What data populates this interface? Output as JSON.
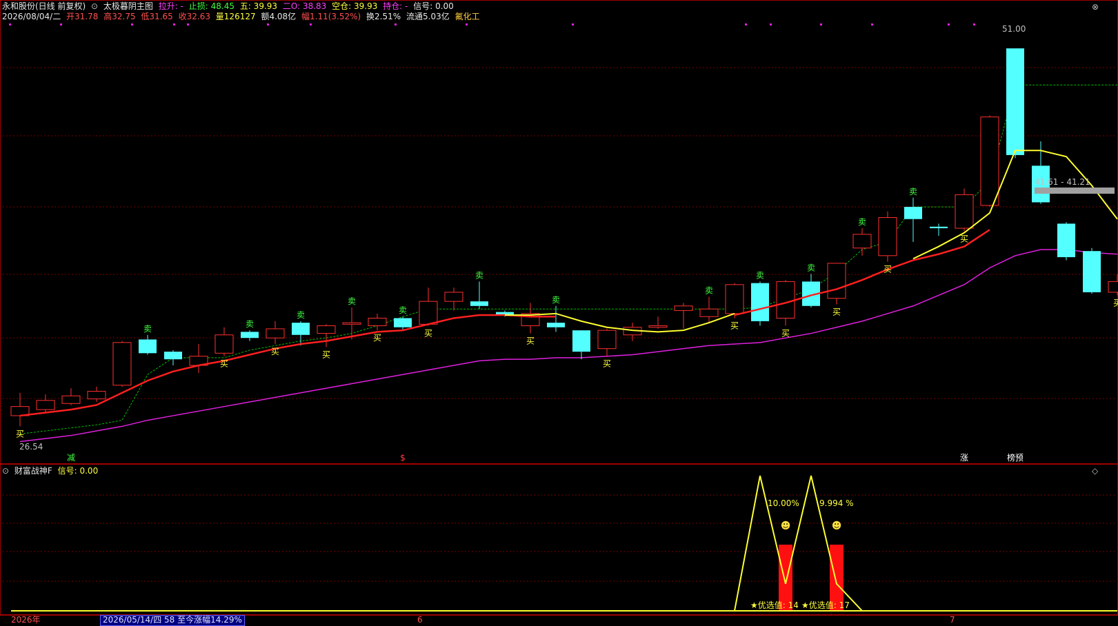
{
  "header": {
    "stock": "永和股份(日线 前复权)",
    "indicator": "太极暮阴主图",
    "pull_label": "拉升: -",
    "stop_loss": "止损: 48.45",
    "five": "五: 39.93",
    "two_o": "二O: 38.83",
    "short": "空仓: 39.93",
    "hold": "持仓: -",
    "signal": "信号: 0.00"
  },
  "quote": {
    "date": "2026/08/04/二",
    "open": "开31.78",
    "high": "高32.75",
    "low": "低31.65",
    "close": "收32.63",
    "volume": "量126127",
    "amount": "额4.08亿",
    "change": "幅1.11(3.52%)",
    "turnover": "换2.51%",
    "float": "流通5.03亿",
    "sector": "氟化工"
  },
  "sub": {
    "title": "财富战神F",
    "signal": "信号: 0.00",
    "pct1": "10.00%",
    "pct2": "9.994 %",
    "best1": "★优选值: 14",
    "best2": "★优选值: 17"
  },
  "bottom": {
    "year": "2026年",
    "date_info": "2026/05/14/四 58 至今涨幅14.29%",
    "m6": "6",
    "m7": "7"
  },
  "colors": {
    "up": "#ff3030",
    "down": "#54ffff",
    "ma_red": "#ff2020",
    "ma_yellow": "#ffff30",
    "ma_mag": "#e020e0",
    "dash_green": "#00c000",
    "buy": "#ffff40",
    "sell": "#40ff40"
  },
  "chart_data": {
    "type": "candlestick",
    "y_axis": "price (CNY)",
    "ylim": [
      24.5,
      52.5
    ],
    "grid": true,
    "price_labels": {
      "high_label": "51.00",
      "low_label": "26.54",
      "range_label": "41.61 - 41.21"
    },
    "candles": [
      {
        "o": 26.9,
        "c": 27.5,
        "h": 28.4,
        "l": 26.2
      },
      {
        "o": 27.3,
        "c": 27.9,
        "h": 28.3,
        "l": 27.1
      },
      {
        "o": 27.7,
        "c": 28.2,
        "h": 28.7,
        "l": 27.6
      },
      {
        "o": 28.0,
        "c": 28.5,
        "h": 28.8,
        "l": 27.8
      },
      {
        "o": 28.9,
        "c": 31.7,
        "h": 31.8,
        "l": 28.8
      },
      {
        "o": 31.9,
        "c": 31.0,
        "h": 32.2,
        "l": 30.9
      },
      {
        "o": 31.1,
        "c": 30.6,
        "h": 31.2,
        "l": 30.2
      },
      {
        "o": 30.2,
        "c": 30.8,
        "h": 31.6,
        "l": 29.7
      },
      {
        "o": 31.0,
        "c": 32.2,
        "h": 32.7,
        "l": 30.8
      },
      {
        "o": 32.4,
        "c": 32.0,
        "h": 32.5,
        "l": 31.8
      },
      {
        "o": 32.0,
        "c": 32.6,
        "h": 33.1,
        "l": 31.6
      },
      {
        "o": 33.0,
        "c": 32.2,
        "h": 33.1,
        "l": 31.5
      },
      {
        "o": 32.3,
        "c": 32.8,
        "h": 32.9,
        "l": 31.4
      },
      {
        "o": 32.9,
        "c": 33.0,
        "h": 34.0,
        "l": 31.9
      },
      {
        "o": 32.8,
        "c": 33.3,
        "h": 33.6,
        "l": 32.5
      },
      {
        "o": 33.3,
        "c": 32.7,
        "h": 33.4,
        "l": 32.5
      },
      {
        "o": 32.9,
        "c": 34.4,
        "h": 35.3,
        "l": 32.8
      },
      {
        "o": 34.4,
        "c": 35.0,
        "h": 35.3,
        "l": 33.8
      },
      {
        "o": 34.4,
        "c": 34.1,
        "h": 35.7,
        "l": 33.9
      },
      {
        "o": 33.7,
        "c": 33.5,
        "h": 33.8,
        "l": 33.4
      },
      {
        "o": 32.8,
        "c": 33.6,
        "h": 34.3,
        "l": 32.3
      },
      {
        "o": 33.0,
        "c": 32.7,
        "h": 34.1,
        "l": 32.4
      },
      {
        "o": 32.5,
        "c": 31.1,
        "h": 32.5,
        "l": 30.6
      },
      {
        "o": 31.3,
        "c": 32.5,
        "h": 32.6,
        "l": 30.8
      },
      {
        "o": 32.2,
        "c": 32.7,
        "h": 33.0,
        "l": 31.8
      },
      {
        "o": 32.7,
        "c": 32.8,
        "h": 33.4,
        "l": 32.6
      },
      {
        "o": 33.8,
        "c": 34.1,
        "h": 34.3,
        "l": 32.6
      },
      {
        "o": 33.4,
        "c": 33.9,
        "h": 34.7,
        "l": 33.0
      },
      {
        "o": 33.6,
        "c": 35.5,
        "h": 35.6,
        "l": 33.3
      },
      {
        "o": 35.6,
        "c": 33.1,
        "h": 35.7,
        "l": 32.8
      },
      {
        "o": 33.3,
        "c": 35.7,
        "h": 35.8,
        "l": 32.8
      },
      {
        "o": 35.7,
        "c": 34.1,
        "h": 36.2,
        "l": 34.0
      },
      {
        "o": 34.6,
        "c": 36.9,
        "h": 36.9,
        "l": 34.2
      },
      {
        "o": 37.9,
        "c": 38.8,
        "h": 39.2,
        "l": 37.4
      },
      {
        "o": 37.4,
        "c": 39.9,
        "h": 40.3,
        "l": 37.0
      },
      {
        "o": 40.6,
        "c": 39.8,
        "h": 41.2,
        "l": 38.3
      },
      {
        "o": 39.3,
        "c": 39.2,
        "h": 39.5,
        "l": 38.7
      },
      {
        "o": 39.2,
        "c": 41.4,
        "h": 41.8,
        "l": 39.0
      },
      {
        "o": 40.7,
        "c": 46.5,
        "h": 46.6,
        "l": 40.6
      },
      {
        "o": 51.0,
        "c": 44.0,
        "h": 51.0,
        "l": 43.8
      },
      {
        "o": 43.3,
        "c": 40.9,
        "h": 44.9,
        "l": 40.8
      },
      {
        "o": 39.5,
        "c": 37.3,
        "h": 39.6,
        "l": 37.1
      },
      {
        "o": 37.7,
        "c": 35.0,
        "h": 37.9,
        "l": 34.9
      },
      {
        "o": 35.0,
        "c": 35.7,
        "h": 36.2,
        "l": 34.8
      }
    ],
    "ma_red": [
      26.9,
      27.1,
      27.3,
      27.6,
      28.4,
      29.2,
      29.8,
      30.2,
      30.5,
      30.9,
      31.3,
      31.6,
      31.8,
      32.1,
      32.4,
      32.5,
      32.9,
      33.3,
      33.5,
      33.5,
      33.4,
      33.4,
      null,
      null,
      null,
      null,
      null,
      null,
      33.5,
      33.9,
      34.3,
      34.8,
      35.2,
      35.8,
      36.5,
      37.1,
      37.5,
      38.0,
      39.1,
      null,
      null,
      null,
      null,
      null
    ],
    "ma_yellow": [
      null,
      null,
      null,
      null,
      null,
      null,
      null,
      null,
      null,
      null,
      null,
      null,
      null,
      null,
      null,
      null,
      null,
      null,
      null,
      33.5,
      33.5,
      33.6,
      33.1,
      32.7,
      32.5,
      32.4,
      32.5,
      33.0,
      33.6,
      null,
      null,
      null,
      null,
      null,
      null,
      37.2,
      38.0,
      38.9,
      40.2,
      44.3,
      44.3,
      43.9,
      42.0,
      39.8
    ],
    "ma_mag": [
      25.2,
      25.4,
      25.6,
      25.9,
      26.2,
      26.6,
      26.9,
      27.2,
      27.5,
      27.8,
      28.1,
      28.4,
      28.7,
      29.0,
      29.3,
      29.6,
      29.9,
      30.2,
      30.5,
      30.6,
      30.6,
      30.7,
      30.7,
      30.8,
      30.9,
      31.1,
      31.3,
      31.5,
      31.6,
      31.7,
      32.0,
      32.3,
      32.7,
      33.1,
      33.6,
      34.1,
      34.8,
      35.5,
      36.6,
      37.4,
      37.8,
      37.8,
      37.6,
      37.5
    ],
    "dash_green": [
      25.7,
      25.9,
      26.1,
      26.3,
      26.6,
      29.6,
      30.7,
      30.7,
      30.7,
      31.2,
      31.5,
      31.8,
      32.0,
      32.3,
      32.8,
      33.4,
      33.9,
      33.9,
      33.9,
      33.9,
      33.9,
      33.9,
      33.9,
      33.9,
      33.9,
      33.9,
      33.9,
      33.9,
      33.9,
      34.0,
      34.6,
      35.2,
      36.3,
      37.8,
      38.3,
      40.6,
      40.6,
      40.6,
      42.3,
      48.6,
      48.6,
      48.6,
      48.6,
      48.6
    ],
    "buy_markers": [
      0,
      8,
      10,
      12,
      14,
      16,
      20,
      23,
      28,
      30,
      32,
      34,
      37,
      43
    ],
    "sell_markers": [
      5,
      9,
      11,
      13,
      15,
      18,
      21,
      27,
      29,
      31,
      33,
      35
    ],
    "bottom_labels": [
      {
        "i": 2,
        "t": "减",
        "color": "#40ff40"
      },
      {
        "i": 15,
        "t": "$",
        "color": "#ff4040"
      },
      {
        "i": 37,
        "t": "涨",
        "color": "#ffffff"
      },
      {
        "i": 39,
        "t": "榜预",
        "color": "#ffffff"
      }
    ],
    "sub_line": {
      "x": [
        0,
        28,
        29,
        30,
        31,
        32,
        33,
        34,
        43
      ],
      "y": [
        0,
        0,
        100,
        20,
        100,
        20,
        0,
        0,
        0
      ]
    },
    "sub_bars": [
      30,
      32
    ]
  }
}
